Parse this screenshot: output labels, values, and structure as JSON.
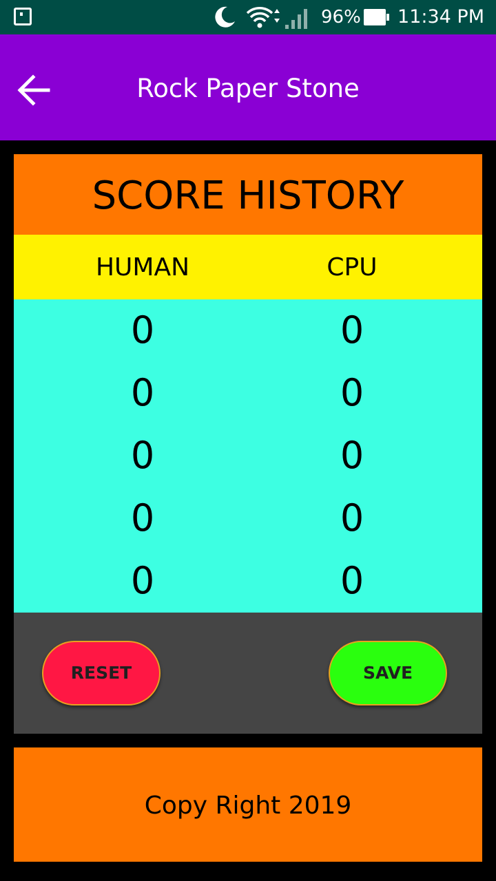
{
  "status_bar": {
    "battery_percent": "96%",
    "time": "11:34 PM",
    "icons": [
      "notification-icon",
      "moon-icon",
      "wifi-icon",
      "signal-icon",
      "battery-icon"
    ]
  },
  "app_bar": {
    "title": "Rock Paper Stone",
    "back_icon": "arrow-left-icon"
  },
  "score_history": {
    "title": "SCORE HISTORY",
    "columns": {
      "human": "HUMAN",
      "cpu": "CPU"
    },
    "rows": [
      {
        "human": "0",
        "cpu": "0"
      },
      {
        "human": "0",
        "cpu": "0"
      },
      {
        "human": "0",
        "cpu": "0"
      },
      {
        "human": "0",
        "cpu": "0"
      },
      {
        "human": "0",
        "cpu": "0"
      }
    ]
  },
  "actions": {
    "reset_label": "RESET",
    "save_label": "SAVE"
  },
  "footer": {
    "text": "Copy Right 2019"
  },
  "colors": {
    "status_bar": "#004d45",
    "app_bar": "#8a00d4",
    "header_orange": "#ff7700",
    "columns_yellow": "#fff200",
    "scores_cyan": "#3dffe2",
    "actions_gray": "#454545",
    "reset_red": "#ff1744",
    "save_green": "#2aff0e"
  }
}
